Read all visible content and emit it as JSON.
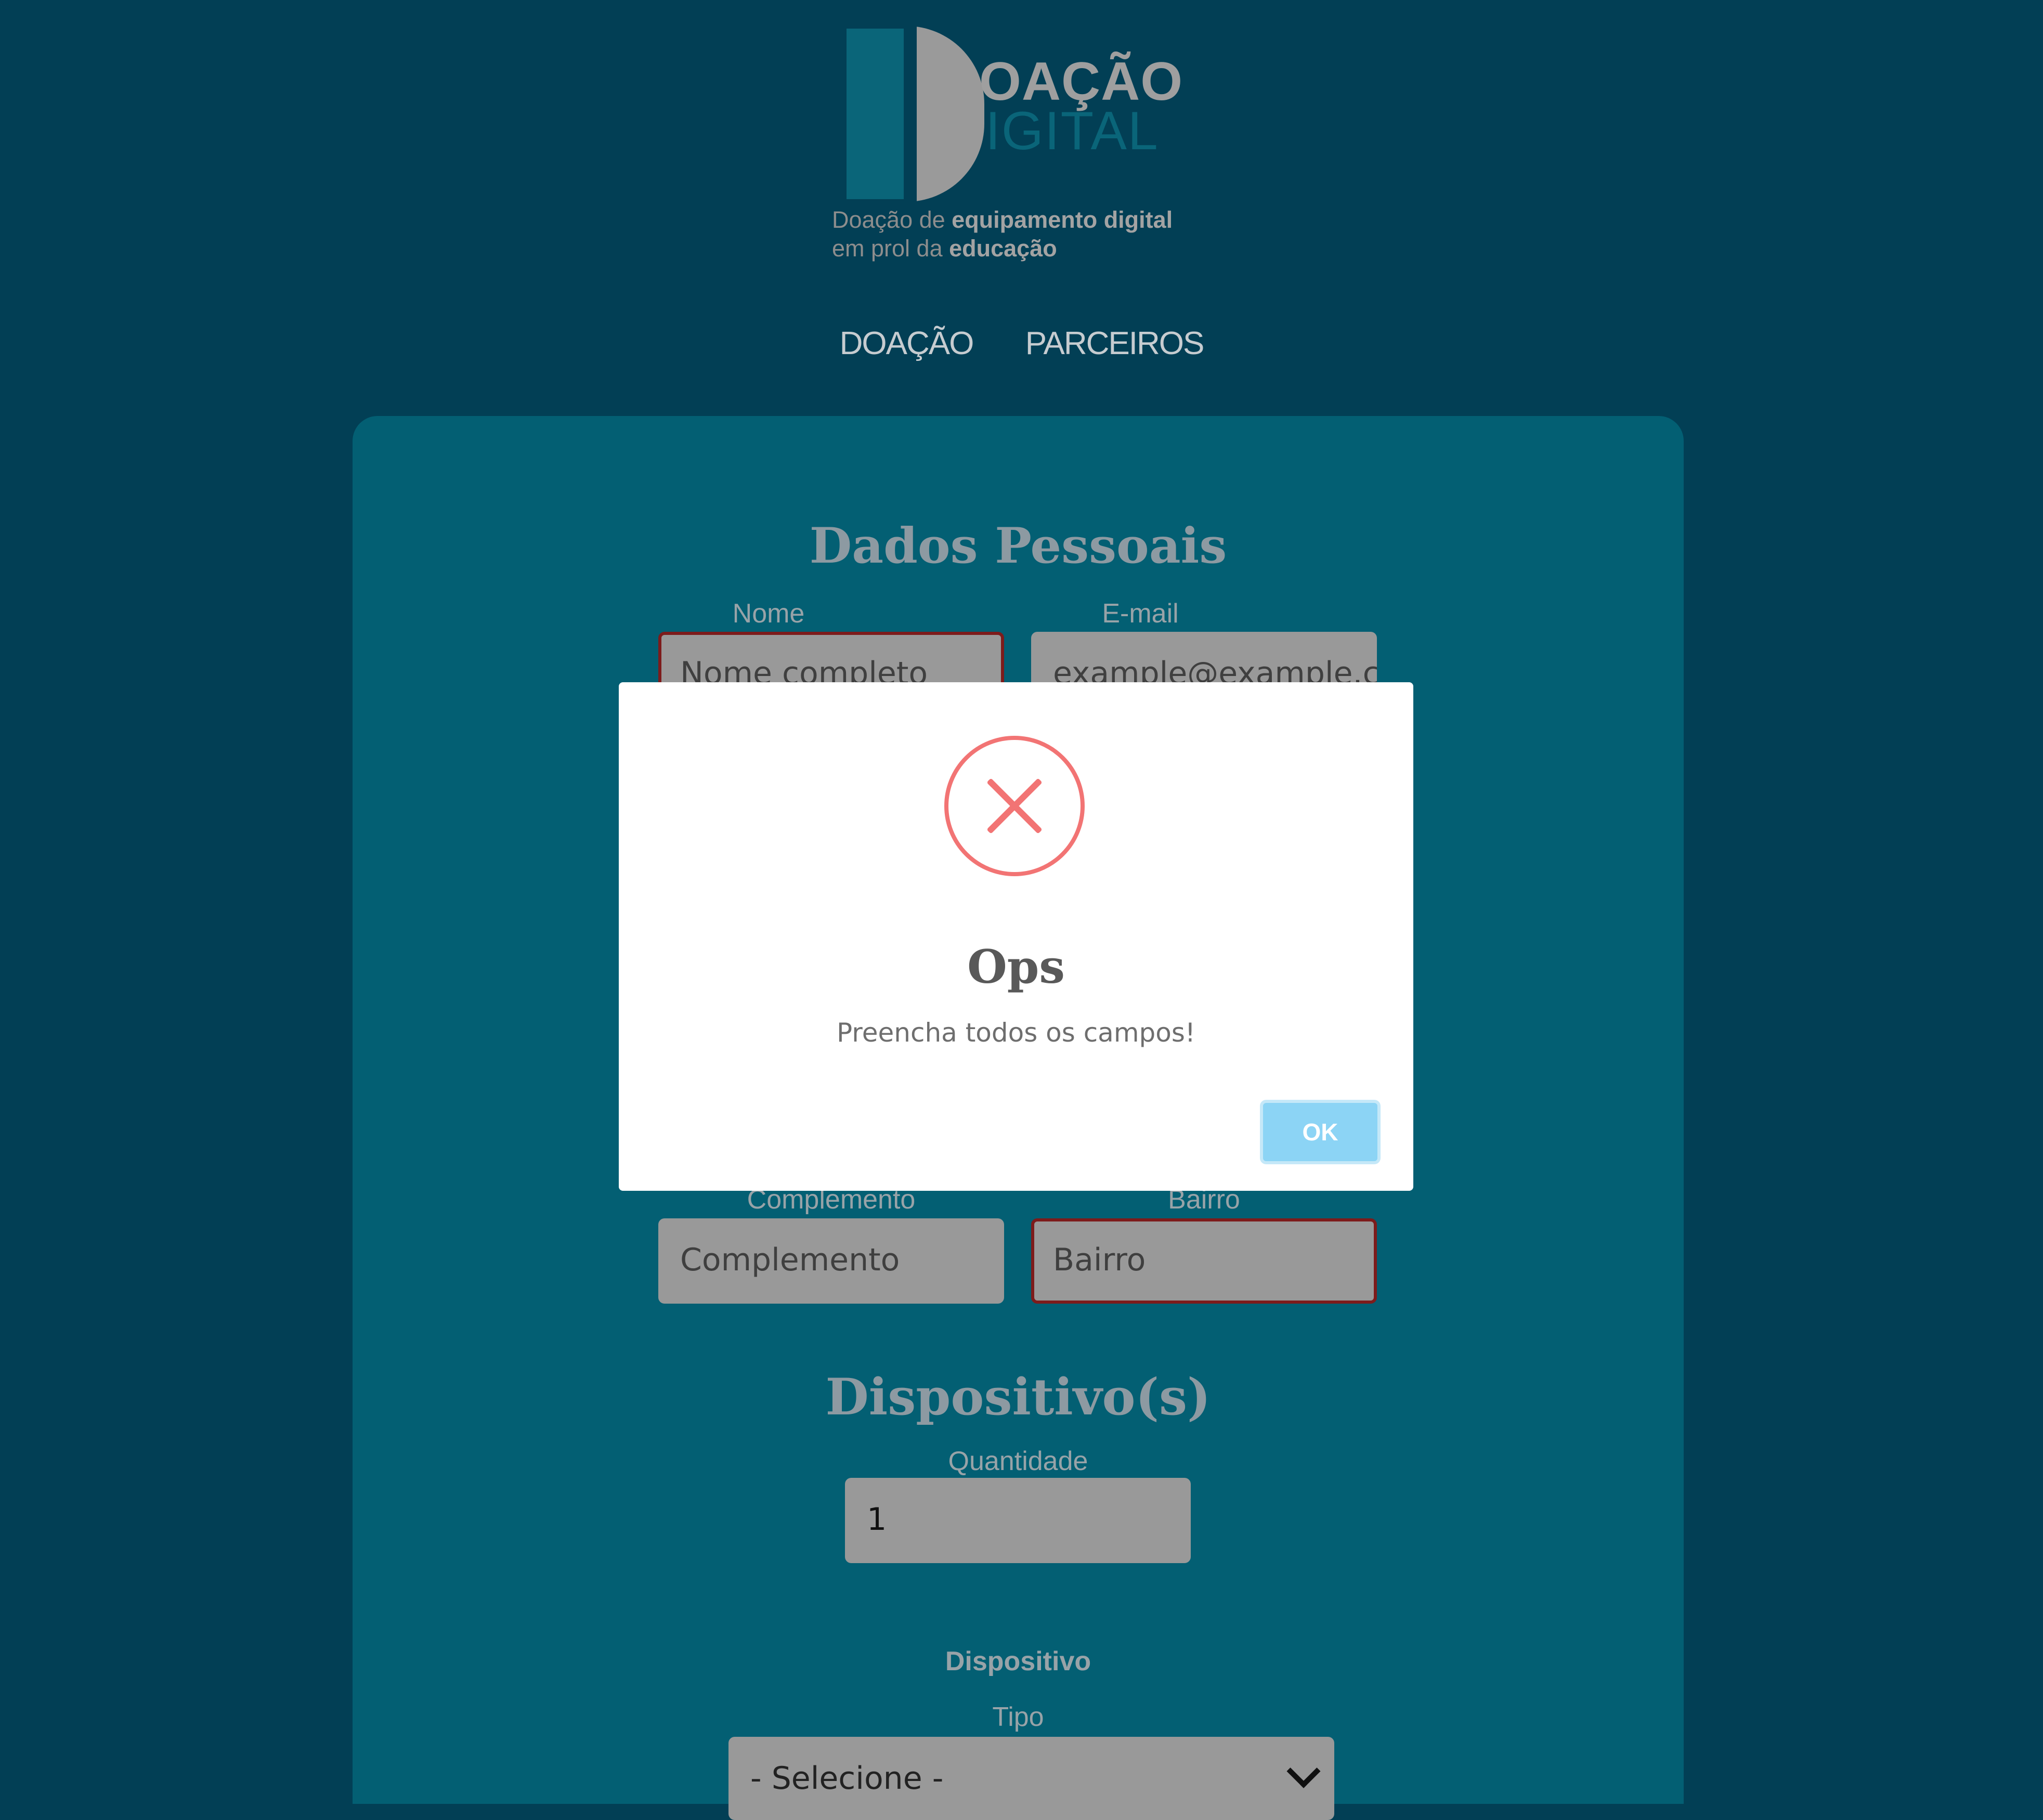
{
  "logo": {
    "word1": "OAÇÃO",
    "word2": "IGITAL",
    "tagline_1a": "Doação de ",
    "tagline_1b": "equipamento digital",
    "tagline_2a": "em prol da ",
    "tagline_2b": "educação"
  },
  "nav": {
    "items": [
      {
        "label": "DOAÇÃO"
      },
      {
        "label": "PARCEIROS"
      }
    ]
  },
  "form": {
    "personal": {
      "title": "Dados Pessoais",
      "nome_label": "Nome",
      "nome_placeholder": "Nome completo",
      "email_label": "E-mail",
      "email_placeholder": "example@example.com",
      "complemento_label": "Complemento",
      "complemento_placeholder": "Complemento",
      "bairro_label": "Bairro",
      "bairro_placeholder": "Bairro"
    },
    "devices": {
      "title": "Dispositivo(s)",
      "quantidade_label": "Quantidade",
      "quantidade_value": "1",
      "dispositivo_heading": "Dispositivo",
      "tipo_label": "Tipo",
      "tipo_selected": "- Selecione -"
    }
  },
  "modal": {
    "icon": "error-x-icon",
    "title": "Ops",
    "message": "Preencha todos os campos!",
    "ok_label": "OK"
  },
  "colors": {
    "page_bg": "#023f55",
    "card_bg": "#035f73",
    "error_accent": "#f27474",
    "ok_button": "#8cd4f5"
  }
}
